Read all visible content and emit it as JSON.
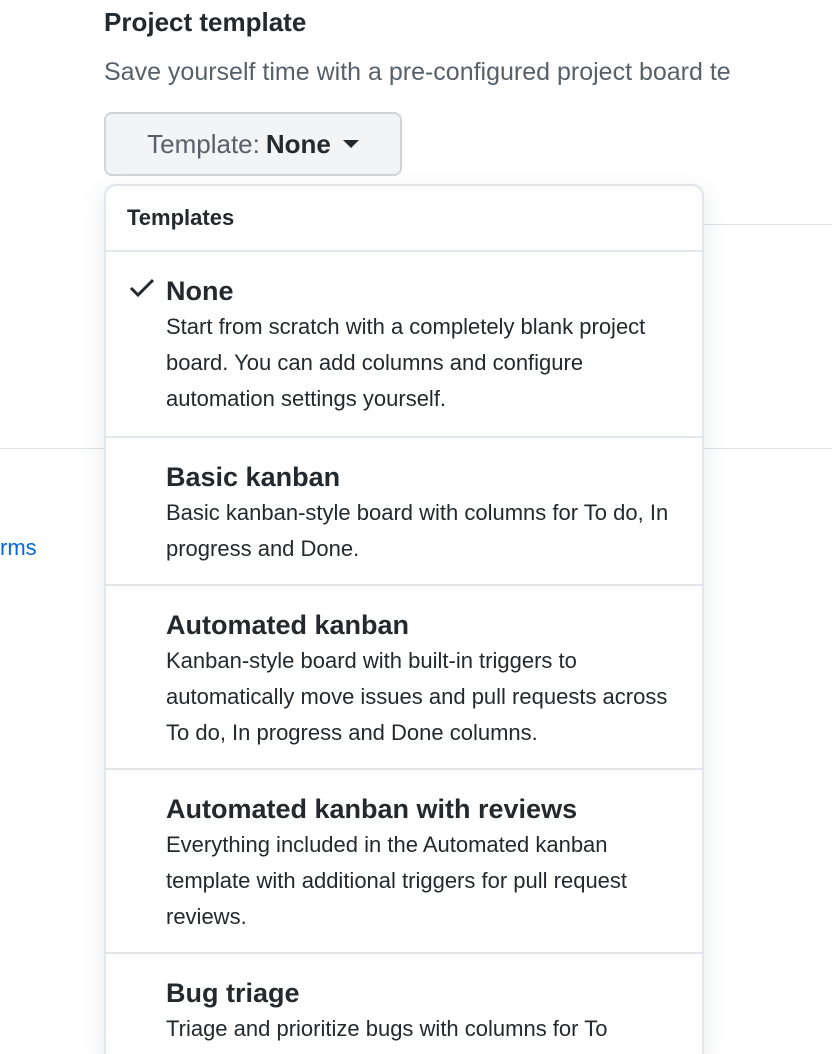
{
  "page": {
    "side_link": "rms"
  },
  "project_template": {
    "title": "Project template",
    "description": "Save yourself time with a pre-configured project board te",
    "select": {
      "prefix": "Template:",
      "value": "None"
    }
  },
  "menu": {
    "header": "Templates",
    "items": [
      {
        "name": "None",
        "selected": true,
        "description": "Start from scratch with a completely blank project board. You can add columns and configure automation settings yourself."
      },
      {
        "name": "Basic kanban",
        "selected": false,
        "description": "Basic kanban-style board with columns for To do, In progress and Done."
      },
      {
        "name": "Automated kanban",
        "selected": false,
        "description": "Kanban-style board with built-in triggers to automatically move issues and pull requests across To do, In progress and Done columns."
      },
      {
        "name": "Automated kanban with reviews",
        "selected": false,
        "description": "Everything included in the Automated kanban template with additional triggers for pull request reviews."
      },
      {
        "name": "Bug triage",
        "selected": false,
        "description": "Triage and prioritize bugs with columns for To"
      }
    ]
  },
  "icons": {
    "selected_indicator": "check-icon",
    "dropdown_indicator": "caret-down-icon"
  },
  "colors": {
    "link": "#0366d6",
    "text": "#24292e",
    "muted": "#586069",
    "border": "#e1e4e8"
  }
}
